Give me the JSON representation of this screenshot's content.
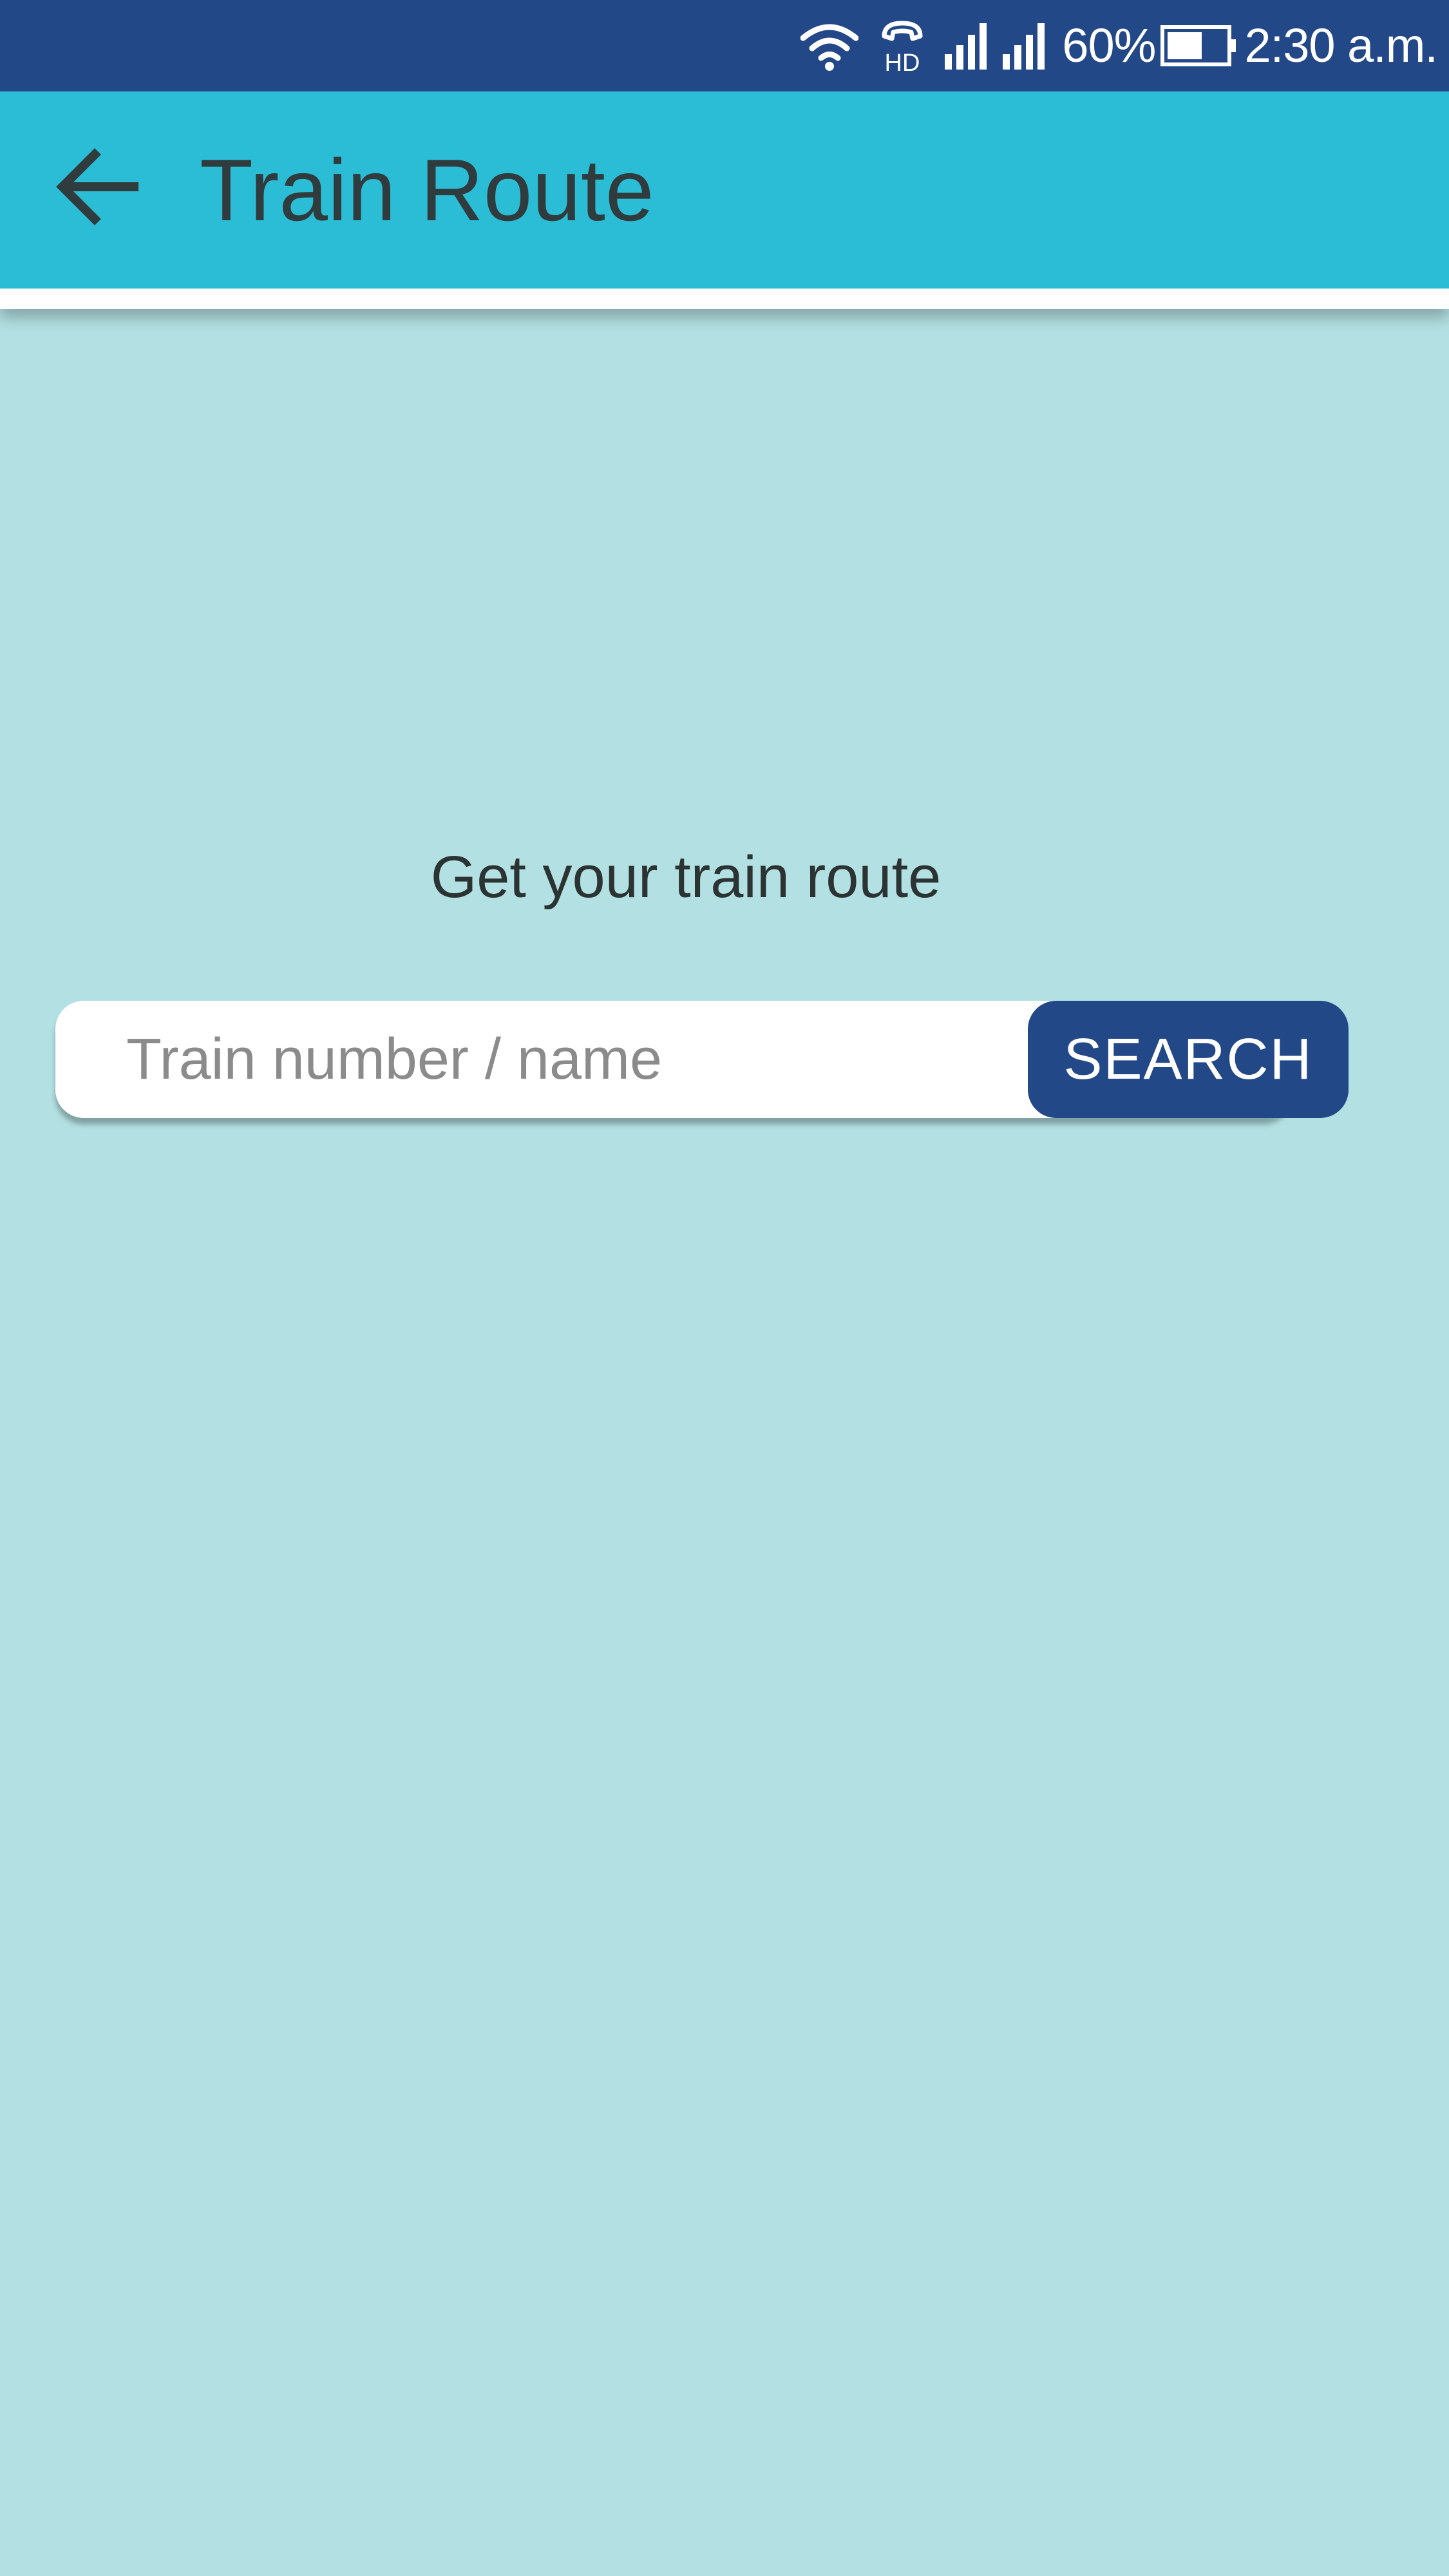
{
  "status_bar": {
    "battery_percent": "60%",
    "battery_level": 0.6,
    "time": "2:30 a.m.",
    "hd_label": "HD",
    "icons": [
      "wifi-icon",
      "hd-call-icon",
      "signal-icon",
      "signal-icon",
      "battery-icon"
    ],
    "background_color": "#234888"
  },
  "app_bar": {
    "title": "Train Route",
    "back_icon": "arrow-left-icon",
    "background_color": "#2bbdd6"
  },
  "main": {
    "prompt": "Get your train route",
    "search": {
      "placeholder": "Train number / name",
      "value": "",
      "button_label": "SEARCH",
      "button_color": "#234888"
    },
    "background_color": "#b3e0e2"
  }
}
